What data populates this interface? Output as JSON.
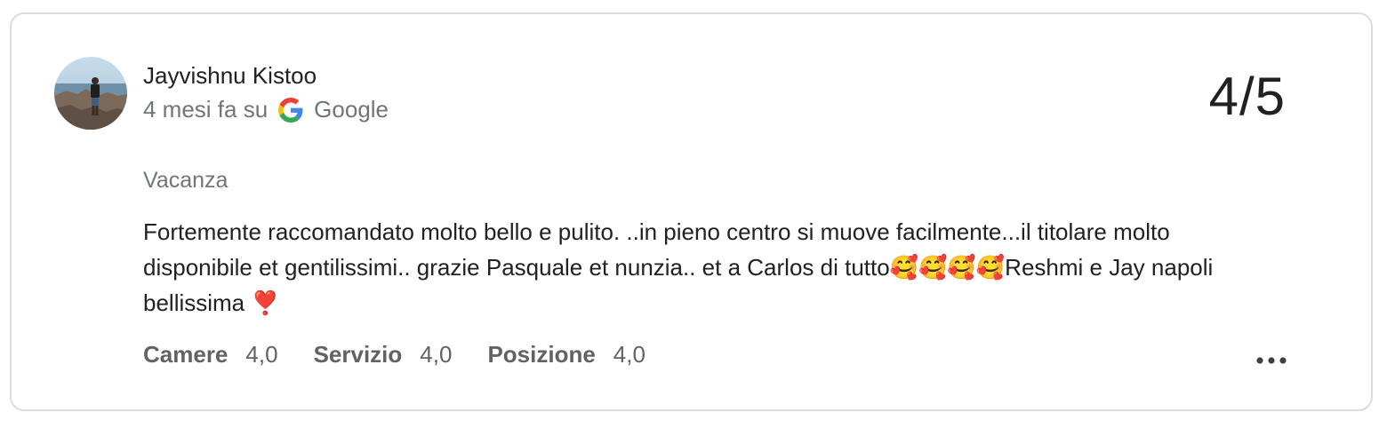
{
  "review": {
    "author": "Jayvishnu Kistoo",
    "time_ago": "4 mesi fa su",
    "source": "Google",
    "score": "4/5",
    "trip_type": "Vacanza",
    "text": "Fortemente raccomandato molto bello e pulito. ..in pieno centro si muove facilmente...il titolare molto disponibile et gentilissimi.. grazie Pasquale et nunzia.. et a Carlos di tutto🥰🥰🥰🥰Reshmi e Jay napoli bellissima ❣️",
    "ratings": [
      {
        "label": "Camere",
        "value": "4,0"
      },
      {
        "label": "Servizio",
        "value": "4,0"
      },
      {
        "label": "Posizione",
        "value": "4,0"
      }
    ]
  },
  "icons": {
    "source_logo": "google-g-icon",
    "more": "more-options-icon"
  },
  "colors": {
    "border": "#dadce0",
    "text_primary": "#202124",
    "text_secondary": "#70757a",
    "rating_label": "#5f6368"
  }
}
